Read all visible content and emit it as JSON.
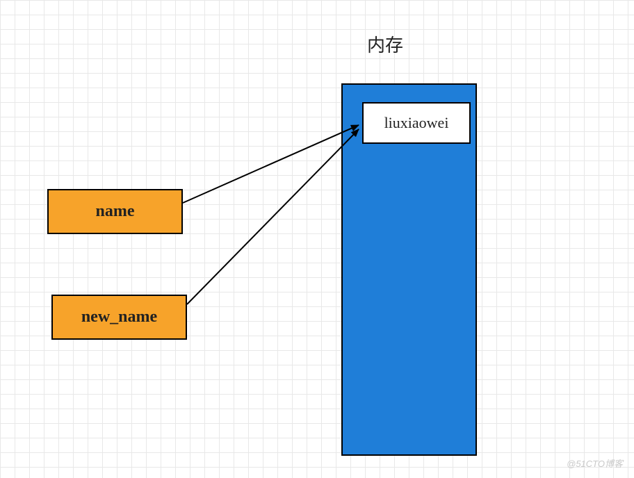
{
  "title": "内存",
  "memory_value": "liuxiaowei",
  "variables": {
    "name": "name",
    "new_name": "new_name"
  },
  "watermark": "@51CTO博客",
  "arrows": [
    {
      "from": "name",
      "to": "memory_value"
    },
    {
      "from": "new_name",
      "to": "memory_value"
    }
  ]
}
